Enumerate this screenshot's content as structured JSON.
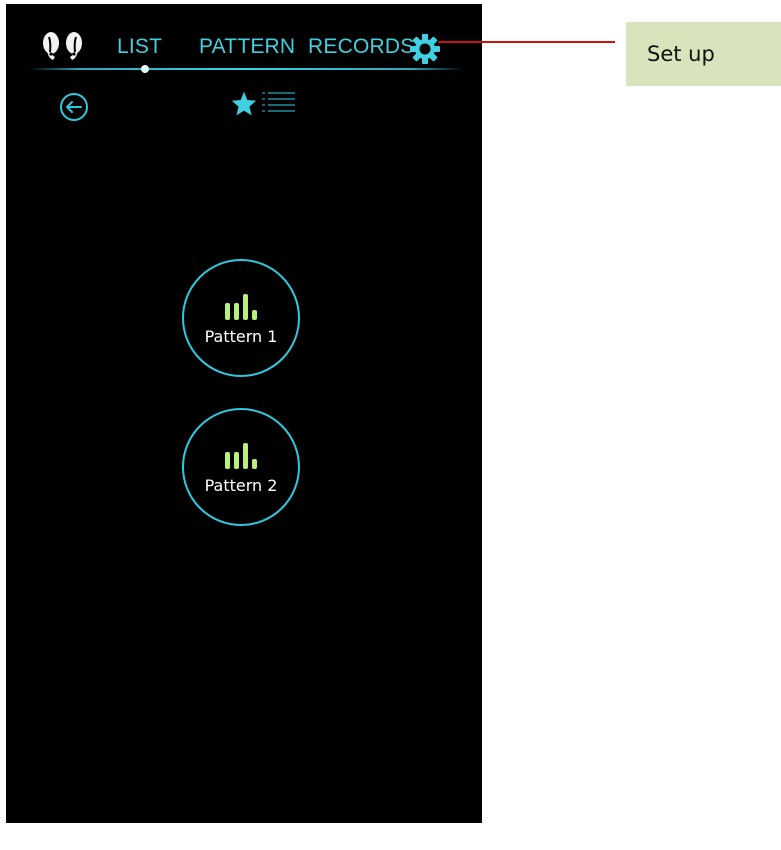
{
  "colors": {
    "screen_background": "#000000",
    "accent": "#2ec9df",
    "bar_icon": "#b9f07a",
    "callout_fill": "#d7e4bc",
    "callout_line": "#d01010"
  },
  "header": {
    "logo_icon": "earbuds-icon",
    "tabs": [
      {
        "label": "LIST",
        "active": true
      },
      {
        "label": "PATTERN",
        "active": false
      },
      {
        "label": "RECORDS",
        "active": false
      }
    ],
    "settings_icon": "gear-icon"
  },
  "toolbar": {
    "back_icon": "back-arrow-icon",
    "favorites_icon": "star-icon",
    "list_icon": "list-icon"
  },
  "patterns": [
    {
      "label": "Pattern 1",
      "icon": "bars-icon"
    },
    {
      "label": "Pattern 2",
      "icon": "bars-icon"
    }
  ],
  "callout": {
    "label": "Set up"
  }
}
